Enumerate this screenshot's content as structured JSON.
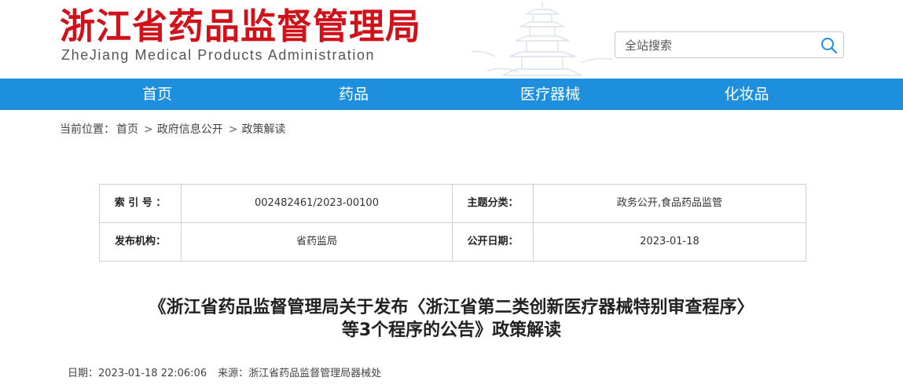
{
  "header": {
    "logo_cn": "浙江省药品监督管理局",
    "logo_en": "ZheJiang Medical Products Administration",
    "search": {
      "placeholder": "全站搜索"
    }
  },
  "nav": {
    "items": [
      {
        "label": "首页"
      },
      {
        "label": "药品"
      },
      {
        "label": "医疗器械"
      },
      {
        "label": "化妆品"
      }
    ]
  },
  "breadcrumb": {
    "prefix": "当前位置：",
    "items": [
      "首页",
      "政府信息公开",
      "政策解读"
    ],
    "separator": ">"
  },
  "info": {
    "index_label": "索 引 号 ：",
    "index_value": "002482461/2023-00100",
    "subject_label": "主题分类：",
    "subject_value": "政务公开,食品药品监管",
    "publisher_label": "发布机构：",
    "publisher_value": "省药监局",
    "date_label": "公开日期：",
    "date_value": "2023-01-18"
  },
  "article": {
    "title_line1": "《浙江省药品监督管理局关于发布〈浙江省第二类创新医疗器械特别审查程序〉",
    "title_line2": "等3个程序的公告》政策解读",
    "date_label": "日期：",
    "date_value": "2023-01-18 22:06:06",
    "source_label": "来源：",
    "source_value": "浙江省药品监督管理局器械处"
  },
  "colors": {
    "brand_red": "#d0121b",
    "nav_blue": "#1e8fdd"
  }
}
